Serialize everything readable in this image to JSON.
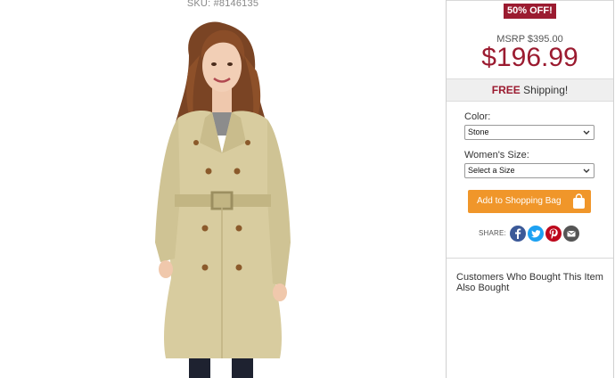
{
  "product": {
    "sku_text": "SKU: #8146135",
    "image_alt": "Woman wearing a belted stone trench coat"
  },
  "pricing": {
    "discount_badge": "50% OFF!",
    "msrp": "MSRP $395.00",
    "price": "$196.99"
  },
  "shipping": {
    "free_label": "FREE",
    "rest_label": "Shipping!"
  },
  "options": {
    "color_label": "Color:",
    "color_value": "Stone",
    "size_label": "Women's Size:",
    "size_value": "Select a Size"
  },
  "actions": {
    "add_to_bag_label": "Add to Shopping Bag"
  },
  "share": {
    "label": "SHARE:",
    "icons": [
      "facebook-icon",
      "twitter-icon",
      "pinterest-icon",
      "email-icon"
    ],
    "colors": {
      "facebook": "#3b5998",
      "twitter": "#1da1f2",
      "pinterest": "#bd081c",
      "email": "#555555"
    }
  },
  "recommendations": {
    "heading": "Customers Who Bought This Item Also Bought"
  },
  "colors": {
    "accent": "#9b1b30",
    "button": "#f0962a",
    "shipping_bar": "#efefef"
  }
}
